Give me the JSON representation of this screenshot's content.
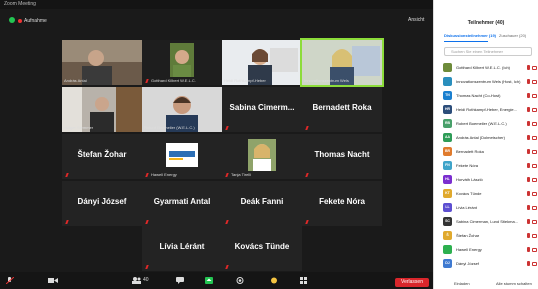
{
  "window": {
    "title": "Zoom Meeting"
  },
  "topbar": {
    "recording_label": "Aufnahme",
    "view_label": "Ansicht"
  },
  "tiles": [
    {
      "id": "t1",
      "label": "András Antal"
    },
    {
      "id": "t2",
      "label": "Gotthard Kilbert W.E.L.C."
    },
    {
      "id": "t3",
      "label": "Heidi Rothkampf-Heber"
    },
    {
      "id": "t4",
      "label": "Innovationszentrum Wels"
    },
    {
      "id": "t5",
      "label": "Holger Stemmer"
    },
    {
      "id": "t6",
      "label": "Robert Boemeiler (W.E.L.C.)"
    },
    {
      "id": "t7",
      "name": "Sabina Cimerm...",
      "label": ""
    },
    {
      "id": "t8",
      "name": "Bernadett Roka",
      "label": ""
    },
    {
      "id": "t9",
      "name": "Štefan Žohar",
      "label": ""
    },
    {
      "id": "t10",
      "label": "Hawell Energy",
      "logo": "beesEnergy"
    },
    {
      "id": "t11",
      "label": "Tanja Tirelli"
    },
    {
      "id": "t12",
      "name": "Thomas Nacht",
      "label": ""
    },
    {
      "id": "t13",
      "name": "Dányi József",
      "label": ""
    },
    {
      "id": "t14",
      "name": "Gyarmati Antal",
      "label": ""
    },
    {
      "id": "t15",
      "name": "Deák Fanni",
      "label": ""
    },
    {
      "id": "t16",
      "name": "Fekete Nóra",
      "label": ""
    },
    {
      "id": "t17",
      "name": "Lívia Léránt",
      "label": ""
    },
    {
      "id": "t18",
      "name": "Kovács Tünde",
      "label": ""
    }
  ],
  "toolbar": {
    "leave_label": "Verlassen",
    "participant_count": "40"
  },
  "panel": {
    "title": "Teilnehmer (40)",
    "tab_active": "Diskussionsteilnehmer (19)",
    "tab_other": "Zuschauer (20)",
    "search_placeholder": "Suchen Sie einen Teilnehmer",
    "participants": [
      {
        "initials": "",
        "name": "Gotthard Kilbert W.E.L.C. (Ich)",
        "color": "#6d8b3a"
      },
      {
        "initials": "",
        "name": "Innovationszentrum Wels (Host, Ich)",
        "color": "#2a8fbd"
      },
      {
        "initials": "TN",
        "name": "Thomas Nacht (Co-Host)",
        "color": "#1a7fcf"
      },
      {
        "initials": "HR",
        "name": "Heidi Rothkampf-Heber, Energie...",
        "color": "#2c4d7a"
      },
      {
        "initials": "RB",
        "name": "Robert Boemeiler (W.E.L.C.)",
        "color": "#48a06a"
      },
      {
        "initials": "AA",
        "name": "András Antal (Dolmetscher)",
        "color": "#2e9c57"
      },
      {
        "initials": "BR",
        "name": "Bernadett Roka",
        "color": "#e07b2d"
      },
      {
        "initials": "FN",
        "name": "Fekete Nóra",
        "color": "#3fa4c9"
      },
      {
        "initials": "HL",
        "name": "Horváth László",
        "color": "#7b2ecf"
      },
      {
        "initials": "KT",
        "name": "Kovács Tünde",
        "color": "#e0a92d"
      },
      {
        "initials": "LL",
        "name": "Lívia Léránt",
        "color": "#5d4fd1"
      },
      {
        "initials": "SC",
        "name": "Sabina Cimerman, Lund Stiekma...",
        "color": "#333333"
      },
      {
        "initials": "Š",
        "name": "Štefan Žohar",
        "color": "#e0a92d"
      },
      {
        "initials": "",
        "name": "Hawell Energy",
        "color": "#2db04f"
      },
      {
        "initials": "DJ",
        "name": "Dányi József",
        "color": "#3f7ad1"
      }
    ],
    "invite_label": "Einladen",
    "muteall_label": "Alle stumm schalten"
  }
}
